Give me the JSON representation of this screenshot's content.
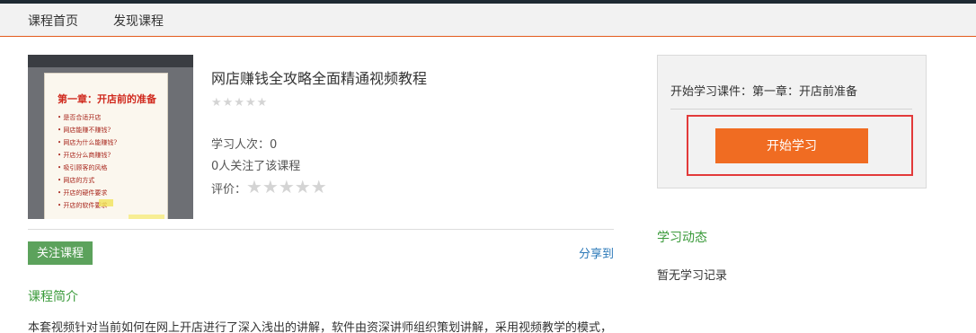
{
  "nav": {
    "items": [
      {
        "label": "课程首页"
      },
      {
        "label": "发现课程"
      }
    ]
  },
  "course": {
    "thumbnail": {
      "slide_title": "第一章：开店前的准备",
      "bullets": [
        "• 是否合适开店",
        "• 网店能赚不赚钱?",
        "• 网店为什么能赚钱?",
        "• 开店分么商赚钱?",
        "• 吸引顾客的风格",
        "• 网店的方式",
        "• 开店的硬件要求",
        "• 开店的软件要求"
      ]
    },
    "title": "网店赚钱全攻略全面精通视频教程",
    "rating_stars": "★★★★★",
    "learners": "学习人次：0",
    "followers": "0人关注了该课程",
    "rating_label": "评价：",
    "rating_stars_large": "★★★★★"
  },
  "actions": {
    "follow_label": "关注课程",
    "share_label": "分享到"
  },
  "intro": {
    "title": "课程简介",
    "text": "本套视频针对当前如何在网上开店进行了深入浅出的讲解，软件由资深讲师组织策划讲解，采用视频教学的模式，"
  },
  "panel": {
    "courseware": "开始学习课件：第一章：开店前准备",
    "start_label": "开始学习"
  },
  "activity": {
    "title": "学习动态",
    "empty": "暂无学习记录"
  },
  "colors": {
    "accent_orange": "#f06c22",
    "follow_green": "#5ca25c",
    "section_green": "#3a9a3a",
    "highlight_red": "#e23a3a",
    "link_blue": "#2a78b8"
  }
}
